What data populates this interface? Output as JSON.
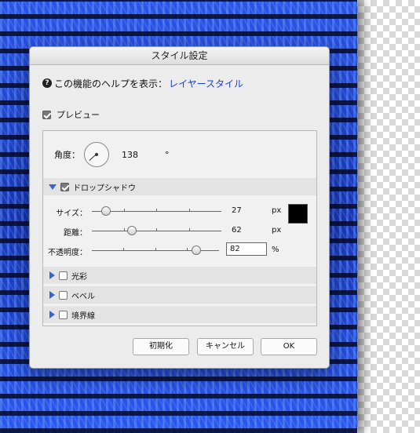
{
  "dialog": {
    "title": "スタイル設定",
    "help_prefix": "この機能のヘルプを表示：",
    "help_link": "レイヤースタイル",
    "preview_label": "プレビュー",
    "preview_checked": true
  },
  "angle": {
    "label": "角度：",
    "value": "138",
    "unit": "°"
  },
  "sections": {
    "drop_shadow": {
      "label": "ドロップシャドウ",
      "checked": true,
      "expanded": true
    },
    "glow": {
      "label": "光彩",
      "checked": false
    },
    "bevel": {
      "label": "ベベル",
      "checked": false
    },
    "stroke": {
      "label": "境界線",
      "checked": false
    }
  },
  "drop_shadow": {
    "size": {
      "label": "サイズ：",
      "value": "27",
      "unit": "px",
      "min": 0,
      "max": 250
    },
    "distance": {
      "label": "距離：",
      "value": "62",
      "unit": "px",
      "min": 0,
      "max": 200
    },
    "opacity": {
      "label": "不透明度：",
      "value": "82",
      "unit": "%",
      "min": 0,
      "max": 100
    },
    "color": "#000000"
  },
  "buttons": {
    "reset": "初期化",
    "cancel": "キャンセル",
    "ok": "OK"
  },
  "colors": {
    "accent": "#3566cc",
    "link": "#1a3fd6",
    "canvas_blue": "#1a3ec8"
  },
  "icons": {
    "help": "help-circle-icon",
    "expand": "triangle-icon"
  }
}
